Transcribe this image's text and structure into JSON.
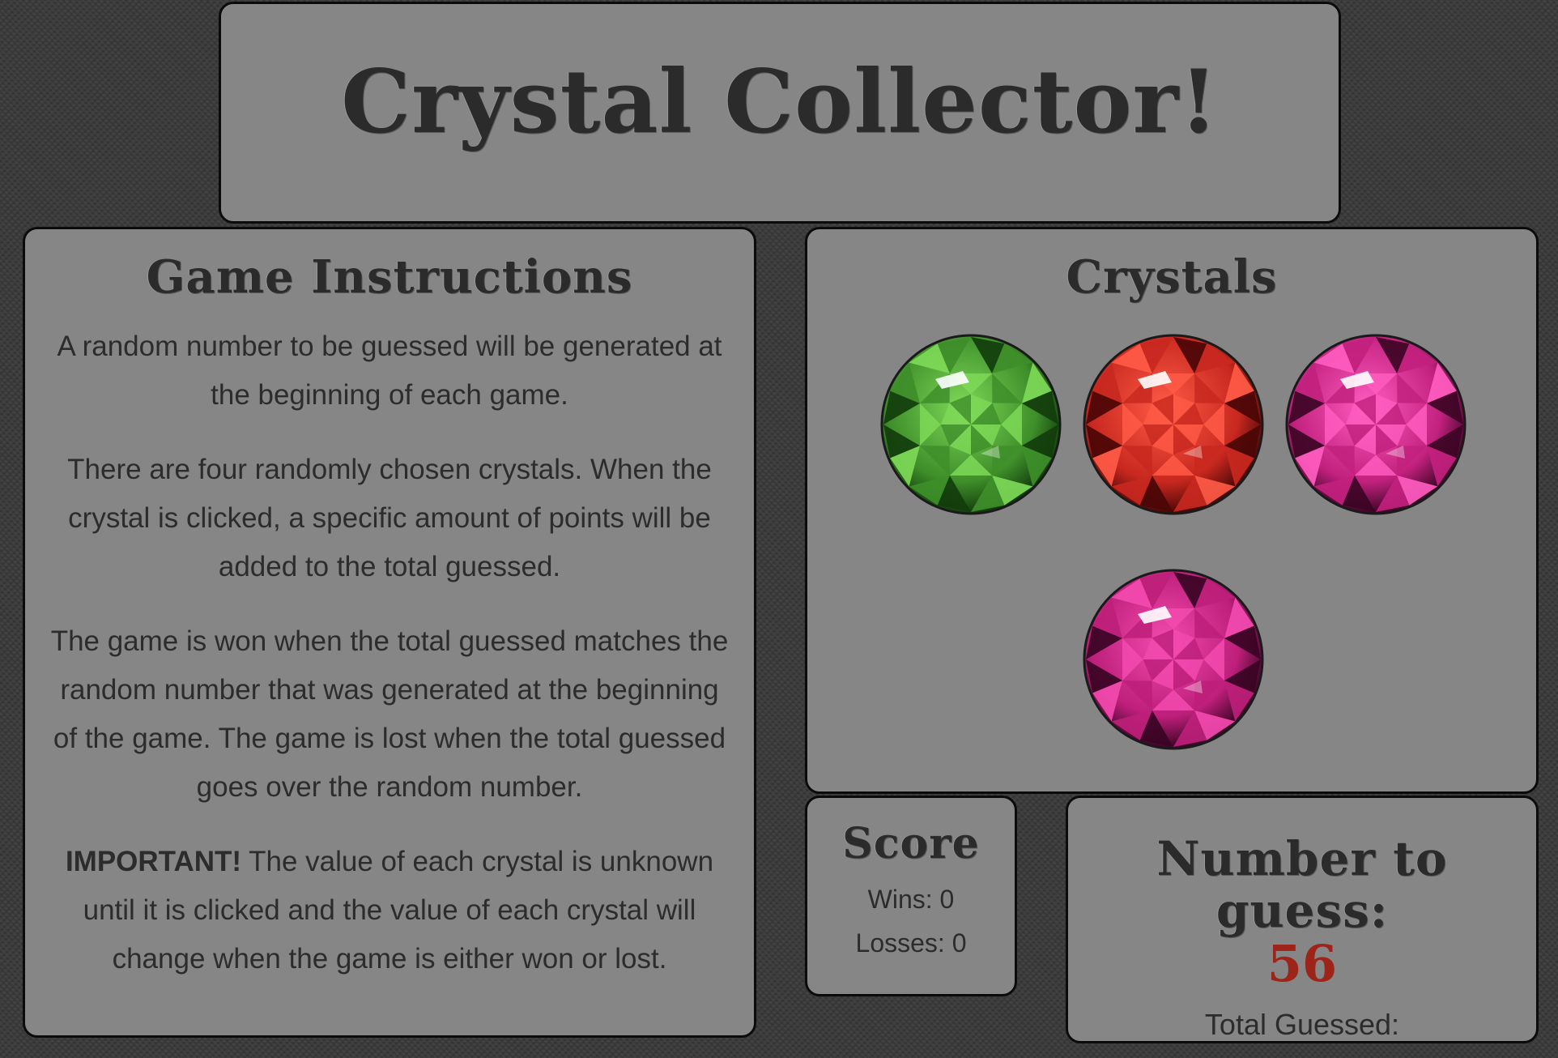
{
  "title": "Crystal Collector!",
  "instructions": {
    "heading": "Game Instructions",
    "paragraph1": "A random number to be guessed will be generated at the beginning of each game.",
    "paragraph2": "There are four randomly chosen crystals. When the crystal is clicked, a specific amount of points will be added to the total guessed.",
    "paragraph3": "The game is won when the total guessed matches the random number that was generated at the beginning of the game. The game is lost when the total guessed goes over the random number.",
    "important_label": "IMPORTANT!",
    "paragraph4": "The value of each crystal is unknown until it is clicked and the value of each crystal will change when the game is either won or lost."
  },
  "crystals": {
    "heading": "Crystals",
    "items": [
      {
        "name": "green-crystal",
        "color": "#3e8e2a",
        "light": "#7ed957",
        "dark": "#123d0c"
      },
      {
        "name": "red-crystal",
        "color": "#c8281f",
        "light": "#ff5a46",
        "dark": "#4a0706"
      },
      {
        "name": "pink-crystal",
        "color": "#c2217e",
        "light": "#ff5cc0",
        "dark": "#3d0525"
      },
      {
        "name": "magenta-crystal",
        "color": "#bd1f7a",
        "light": "#f34aaf",
        "dark": "#3a0424"
      }
    ]
  },
  "score": {
    "heading": "Score",
    "wins_label": "Wins: 0",
    "losses_label": "Losses: 0"
  },
  "guess": {
    "heading": "Number to guess:",
    "target": "56",
    "total_label": "Total Guessed:"
  }
}
